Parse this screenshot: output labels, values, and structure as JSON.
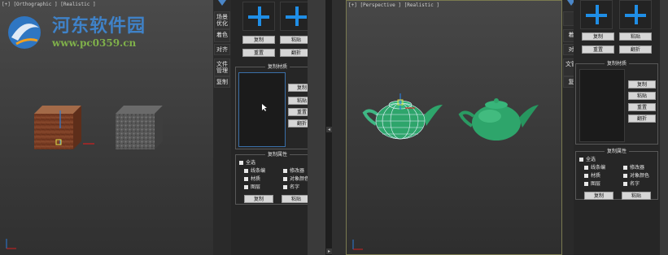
{
  "left_viewport": {
    "label": "[+] [Orthographic ] [Realistic ]"
  },
  "right_viewport": {
    "label": "[+] [Perspective ] [Realistic ]"
  },
  "watermark": {
    "title": "河东软件园",
    "url": "www.pc0359.cn"
  },
  "tabs_left": [
    "场景优化",
    "着色",
    "对齐",
    "文件管理",
    "复制"
  ],
  "tabs_right": [
    "",
    "着",
    "对",
    "文管",
    "复"
  ],
  "panel_left": {
    "buttons_top": [
      "复制",
      "粘贴",
      "重置",
      "翻折"
    ],
    "material_group": {
      "title": "复制材质",
      "buttons": [
        "复制",
        "粘贴",
        "重置",
        "翻折"
      ]
    },
    "attr_group": {
      "title": "复制属性",
      "select_all": "全选",
      "options": [
        "线条编",
        "材质",
        "图层",
        "修改器",
        "对象颜色",
        "名字"
      ],
      "buttons": [
        "复制",
        "粘贴"
      ]
    }
  },
  "panel_right": {
    "buttons_top": [
      "复制",
      "粘贴",
      "重置",
      "翻折"
    ],
    "material_group": {
      "title": "复制材质",
      "buttons": [
        "复制",
        "粘贴",
        "重置",
        "翻折"
      ]
    },
    "attr_group": {
      "title": "复制属性",
      "select_all": "全选",
      "options": [
        "线条编",
        "材质",
        "图层",
        "修改器",
        "对象颜色",
        "名字"
      ],
      "buttons": [
        "复制",
        "粘贴"
      ]
    }
  },
  "colors": {
    "accent": "#1f8ee6",
    "teapot": "#2ea56b",
    "box": "#8a4a2e"
  }
}
